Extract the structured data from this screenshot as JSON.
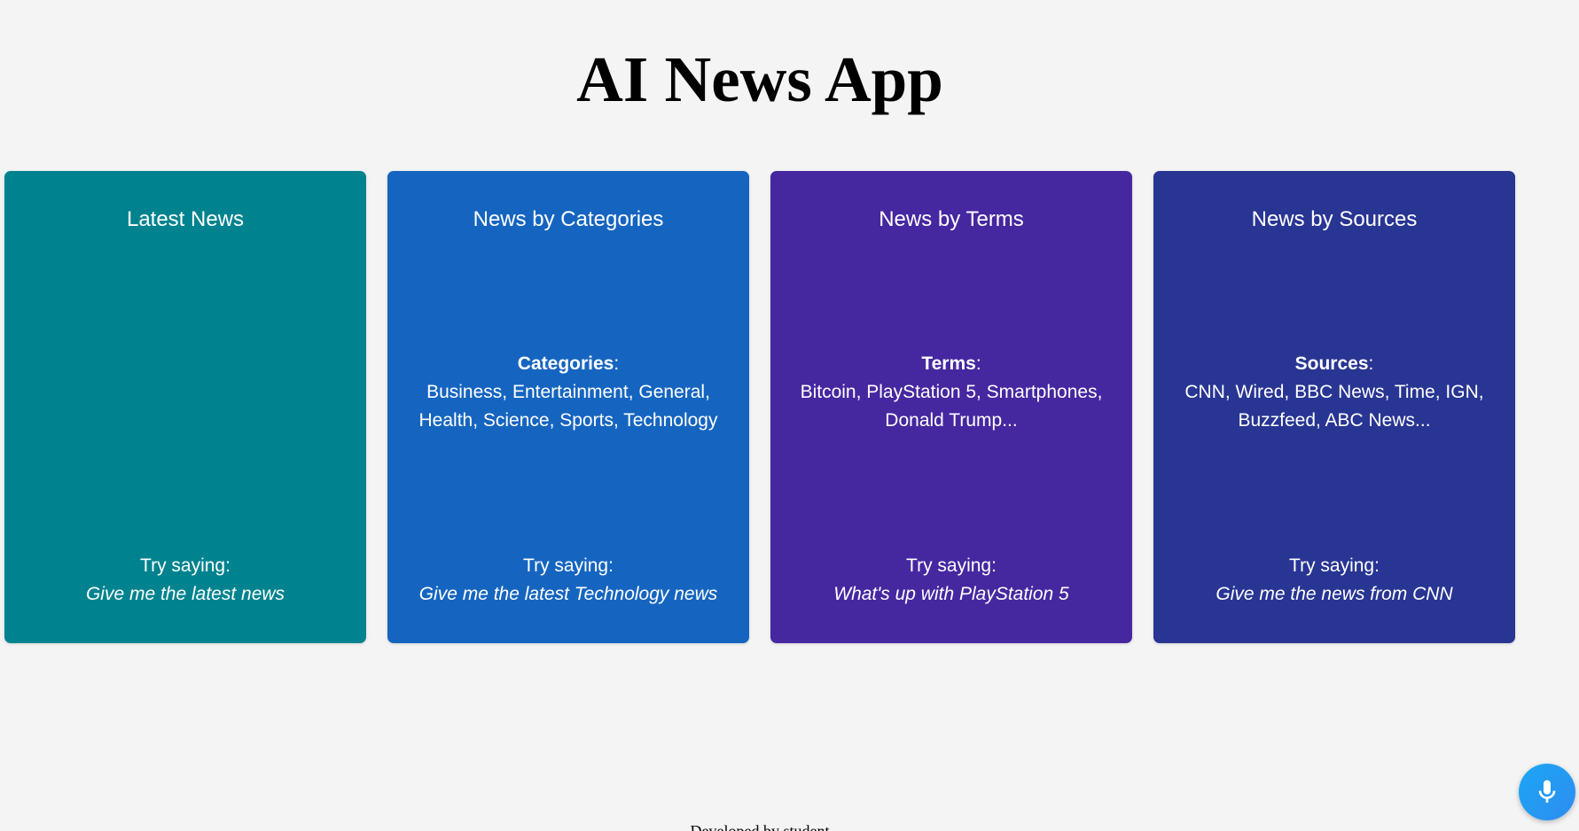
{
  "app": {
    "title": "AI News App",
    "footer": "Developed by student"
  },
  "cards": [
    {
      "title": "Latest News",
      "color": "#00838f",
      "info_label": "",
      "info_text": "",
      "try_label": "Try saying:",
      "try_phrase": "Give me the latest news"
    },
    {
      "title": "News by Categories",
      "color": "#1565c0",
      "info_label": "Categories",
      "info_text": "Business, Entertainment, General, Health, Science, Sports, Technology",
      "try_label": "Try saying:",
      "try_phrase": "Give me the latest Technology news"
    },
    {
      "title": "News by Terms",
      "color": "#4527a0",
      "info_label": "Terms",
      "info_text": "Bitcoin, PlayStation 5, Smartphones, Donald Trump...",
      "try_label": "Try saying:",
      "try_phrase": "What's up with PlayStation 5"
    },
    {
      "title": "News by Sources",
      "color": "#283593",
      "info_label": "Sources",
      "info_text": "CNN, Wired, BBC News, Time, IGN, Buzzfeed, ABC News...",
      "try_label": "Try saying:",
      "try_phrase": "Give me the news from CNN"
    }
  ],
  "voice_button": {
    "icon": "microphone-icon",
    "color": "#1aa7f5"
  }
}
